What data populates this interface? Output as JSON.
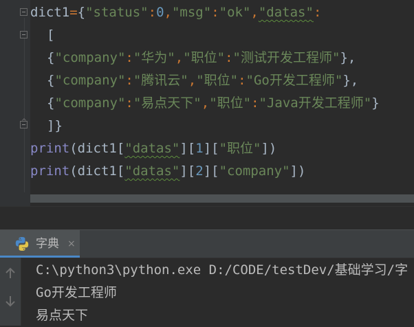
{
  "editor": {
    "line1": {
      "name": "dict1",
      "eq": "=",
      "open": "{",
      "k1": "\"status\"",
      "c1": ":",
      "v1": "0",
      "comma1": ",",
      "k2": "\"msg\"",
      "c2": ":",
      "v2": "\"ok\"",
      "comma2": ",",
      "k3": "\"datas\"",
      "c3": ":"
    },
    "line2": {
      "bracket": "["
    },
    "line3": {
      "open": "{",
      "k": "\"company\"",
      "c1": ":",
      "v": "\"华为\"",
      "comma": ",",
      "k2": "\"职位\"",
      "c2": ":",
      "v2": "\"测试开发工程师\"",
      "close": "},"
    },
    "line4": {
      "open": "{",
      "k": "\"company\"",
      "c1": ":",
      "v": "\"腾讯云\"",
      "comma": ",",
      "k2": "\"职位\"",
      "c2": ":",
      "v2": "\"Go开发工程师\"",
      "close": "},"
    },
    "line5": {
      "open": "{",
      "k": "\"company\"",
      "c1": ":",
      "v": "\"易点天下\"",
      "comma": ",",
      "k2": "\"职位\"",
      "c2": ":",
      "v2": "\"Java开发工程师\"",
      "close": "}"
    },
    "line6": {
      "close": "]}"
    },
    "line7": {
      "fn": "print",
      "a": "(dict1[",
      "k": "\"datas\"",
      "b": "][",
      "n": "1",
      "c": "][",
      "k2": "\"职位\"",
      "d": "])"
    },
    "line8": {
      "fn": "print",
      "a": "(dict1[",
      "k": "\"datas\"",
      "b": "][",
      "n": "2",
      "c": "][",
      "k2": "\"company\"",
      "d": "])"
    }
  },
  "run_panel": {
    "tab_label": "字典",
    "tab_close": "×",
    "output": [
      "C:\\python3\\python.exe D:/CODE/testDev/基础学习/字",
      "Go开发工程师",
      "易点天下"
    ]
  },
  "colors": {
    "background": "#2b2b2b",
    "string": "#6a8759",
    "number": "#6897bb",
    "keyword": "#cc7832",
    "builtin": "#8888c6",
    "text": "#a9b7c6",
    "accent": "#4a88c7"
  },
  "icons": [
    "fold-icon",
    "python-icon",
    "close-icon",
    "arrow-up-icon",
    "arrow-down-icon"
  ]
}
